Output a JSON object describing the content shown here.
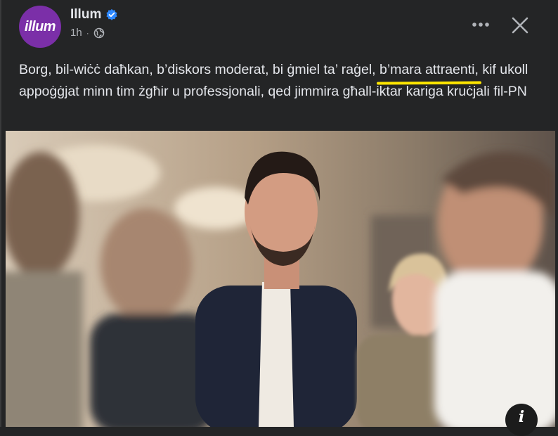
{
  "post": {
    "author": "Illum",
    "avatar_text": "illum",
    "timestamp": "1h",
    "caption_before": "Borg, bil-wiċċ daħkan, b’diskors moderat, bi ġmiel ta’ raġel, ",
    "caption_highlight": "b’mara attraenti,",
    "caption_after": " kif ukoll appoġġjat minn tim żgħir u professjonali, qed jimmira għall-iktar kariga kruċjali fil-PN",
    "info_label": "i"
  },
  "colors": {
    "background": "#242526",
    "brand": "#7b2fa8",
    "verified": "#2d88ff",
    "highlight": "#ffe600"
  },
  "icons": [
    "verified-badge-icon",
    "globe-icon",
    "more-options-icon",
    "close-icon",
    "info-icon"
  ]
}
